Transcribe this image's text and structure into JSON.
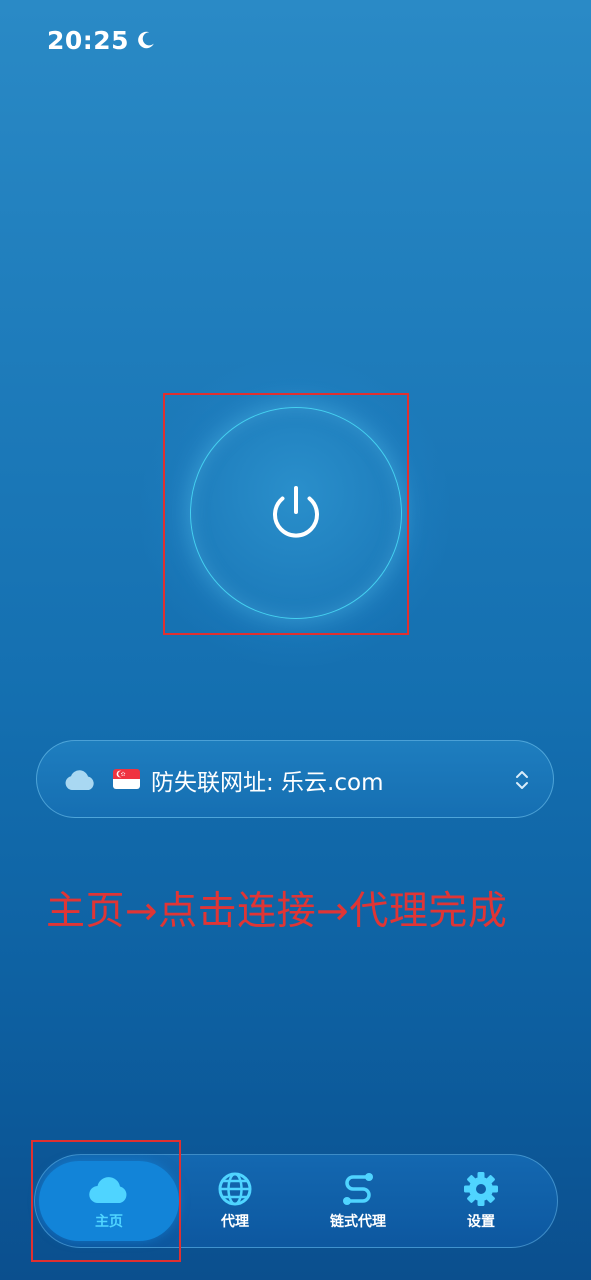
{
  "status_bar": {
    "time": "20:25",
    "dnd_icon": "moon-icon"
  },
  "power": {
    "icon": "power-icon",
    "accent_color": "#45d0f0"
  },
  "server": {
    "cloud_icon": "cloud-icon",
    "flag_icon": "singapore-flag-icon",
    "label": "防失联网址: 乐云.com",
    "chevron_icon": "chevron-up-down-icon"
  },
  "instruction": {
    "text": "主页→点击连接→代理完成",
    "color": "#e03535"
  },
  "nav": {
    "items": [
      {
        "label": "主页",
        "icon": "cloud-icon",
        "active": true
      },
      {
        "label": "代理",
        "icon": "globe-icon",
        "active": false
      },
      {
        "label": "链式代理",
        "icon": "route-icon",
        "active": false
      },
      {
        "label": "设置",
        "icon": "gear-icon",
        "active": false
      }
    ],
    "active_color": "#4fd4ff"
  },
  "annotation_color": "#e03030"
}
